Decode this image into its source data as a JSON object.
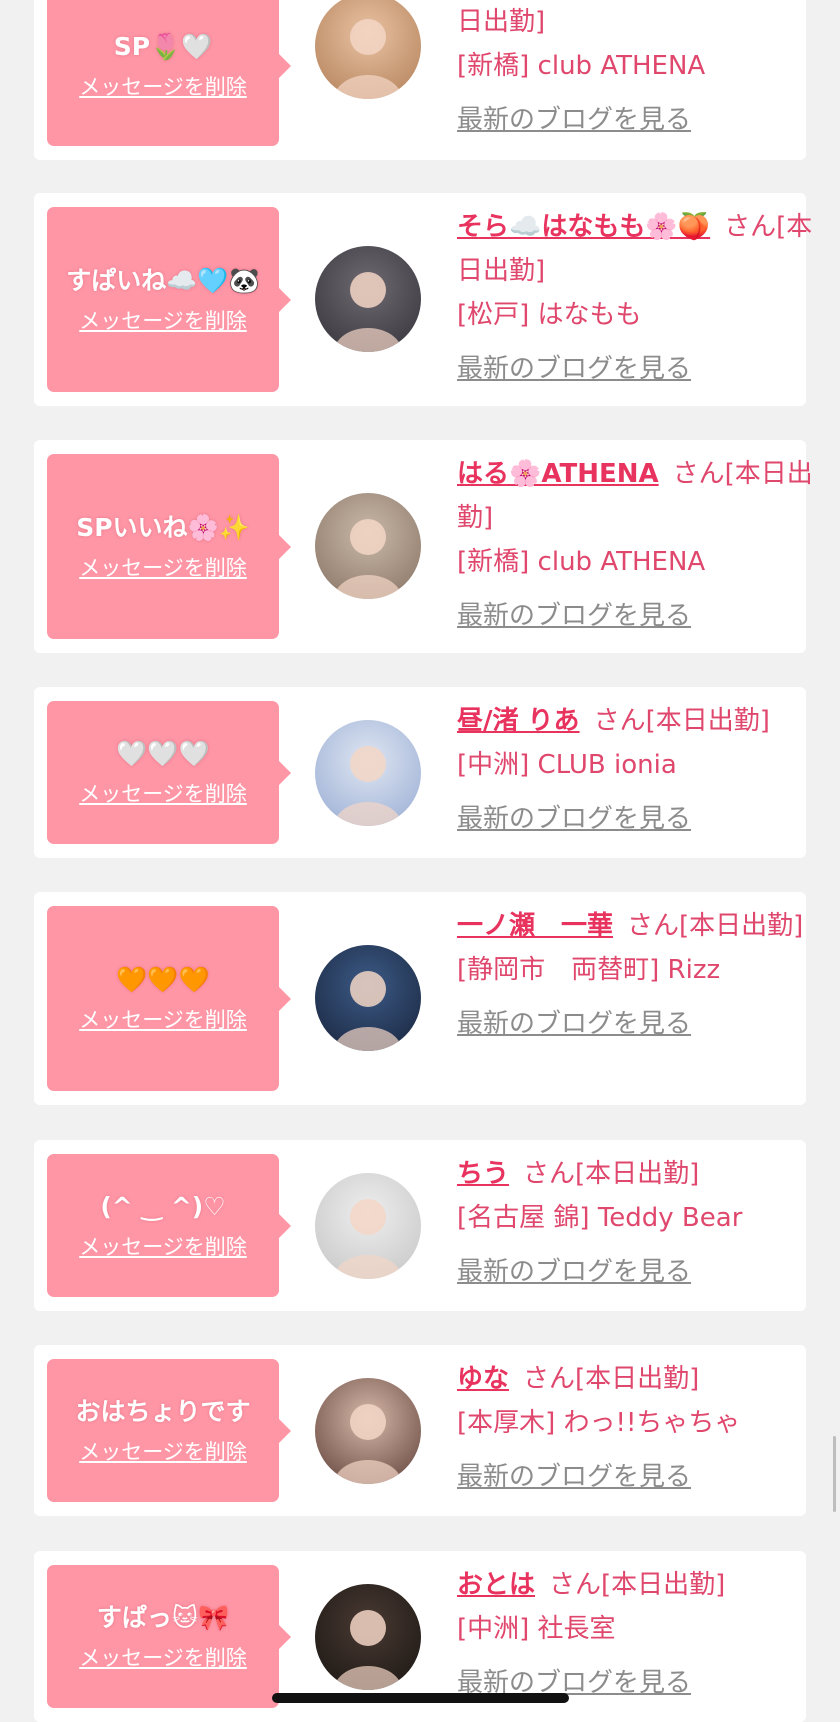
{
  "delete_label": "メッセージを削除",
  "blog_label": "最新のブログを見る",
  "colors": {
    "bubble": "#ff96a6",
    "name": "#e8335f",
    "text": "#e0476d",
    "link_gray": "#8c8c8c"
  },
  "items": [
    {
      "message": "SP🌷🤍",
      "name": "",
      "suffix": "日出勤]",
      "shop": "[新橋] club ATHENA",
      "avatar_icon": "photo-avatar-icon"
    },
    {
      "message": "すぱいね☁️🩵🐼",
      "name": "そら☁️はなもも🌸🍑",
      "suffix": "さん[本日出勤]",
      "shop": "[松戸] はなもも",
      "avatar_icon": "photo-avatar-icon"
    },
    {
      "message": "SPいいね🌸✨",
      "name": "はる🌸ATHENA",
      "suffix": "さん[本日出勤]",
      "shop": "[新橋] club ATHENA",
      "avatar_icon": "photo-avatar-icon"
    },
    {
      "message": "🤍🤍🤍",
      "name": "昼/渚 りあ",
      "suffix": "さん[本日出勤]",
      "shop": "[中洲] CLUB ionia",
      "avatar_icon": "photo-avatar-icon"
    },
    {
      "message": "🧡🧡🧡",
      "name": "一ノ瀬　一華",
      "suffix": "さん[本日出勤]",
      "shop": "[静岡市　両替町] Rizz",
      "avatar_icon": "photo-avatar-icon"
    },
    {
      "message": "(^ ‿ ^)♡",
      "name": "ちう",
      "suffix": "さん[本日出勤]",
      "shop": "[名古屋 錦] Teddy Bear",
      "avatar_icon": "photo-avatar-icon"
    },
    {
      "message": "おはちょりです",
      "name": "ゆな",
      "suffix": "さん[本日出勤]",
      "shop": "[本厚木] わっ!!ちゃちゃ",
      "avatar_icon": "photo-avatar-icon"
    },
    {
      "message": "すぱっ🐱🎀",
      "name": "おとは",
      "suffix": "さん[本日出勤]",
      "shop": "[中洲] 社長室",
      "avatar_icon": "photo-avatar-icon"
    }
  ]
}
